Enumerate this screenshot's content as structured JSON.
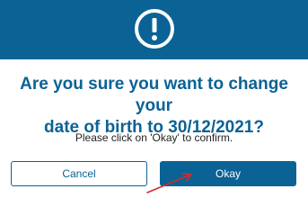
{
  "dialog": {
    "icon": "exclamation-circle-icon",
    "title_line1": "Are you sure you want to change your",
    "title_line2": "date of birth to 30/12/2021?",
    "message": "Please click on 'Okay' to confirm.",
    "cancel_label": "Cancel",
    "okay_label": "Okay"
  },
  "annotation": {
    "icon": "red-arrow-icon",
    "color": "#d42a2a"
  },
  "colors": {
    "accent": "#0b6295",
    "background": "#ffffff"
  }
}
